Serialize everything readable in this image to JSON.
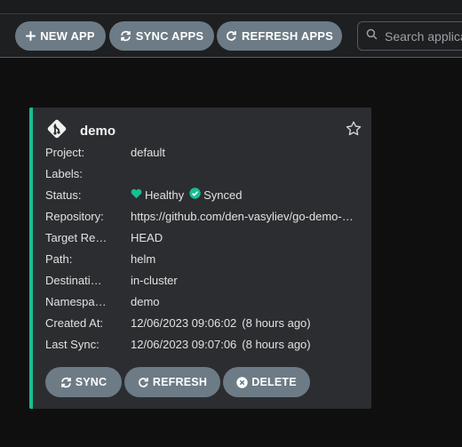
{
  "toolbar": {
    "new_app": "NEW APP",
    "sync_apps": "SYNC APPS",
    "refresh_apps": "REFRESH APPS",
    "search_placeholder": "Search applications..."
  },
  "app": {
    "name": "demo",
    "fields": [
      {
        "label": "Project:",
        "value": "default"
      },
      {
        "label": "Labels:",
        "value": ""
      },
      {
        "label": "Status:",
        "health": "Healthy",
        "sync": "Synced"
      },
      {
        "label": "Repository:",
        "value": "https://github.com/den-vasyliev/go-demo-…"
      },
      {
        "label": "Target Re…",
        "value": "HEAD"
      },
      {
        "label": "Path:",
        "value": "helm"
      },
      {
        "label": "Destinati…",
        "value": "in-cluster"
      },
      {
        "label": "Namespa…",
        "value": "demo"
      },
      {
        "label": "Created At:",
        "value": "12/06/2023 09:06:02",
        "ago": "(8 hours ago)"
      },
      {
        "label": "Last Sync:",
        "value": "12/06/2023 09:07:06",
        "ago": "(8 hours ago)"
      }
    ],
    "buttons": {
      "sync": "SYNC",
      "refresh": "REFRESH",
      "delete": "DELETE"
    }
  },
  "colors": {
    "accent": "#18be94",
    "button": "#6c7b85",
    "card_bg": "#2b2d30",
    "page_bg": "#0f0f10"
  },
  "icons": {
    "new_app": "plus-icon",
    "sync": "sync-icon",
    "refresh": "refresh-icon",
    "search": "search-icon",
    "app": "git-icon",
    "star": "star-icon",
    "health": "heart-icon",
    "synced": "check-circle-icon",
    "delete": "times-circle-icon"
  }
}
